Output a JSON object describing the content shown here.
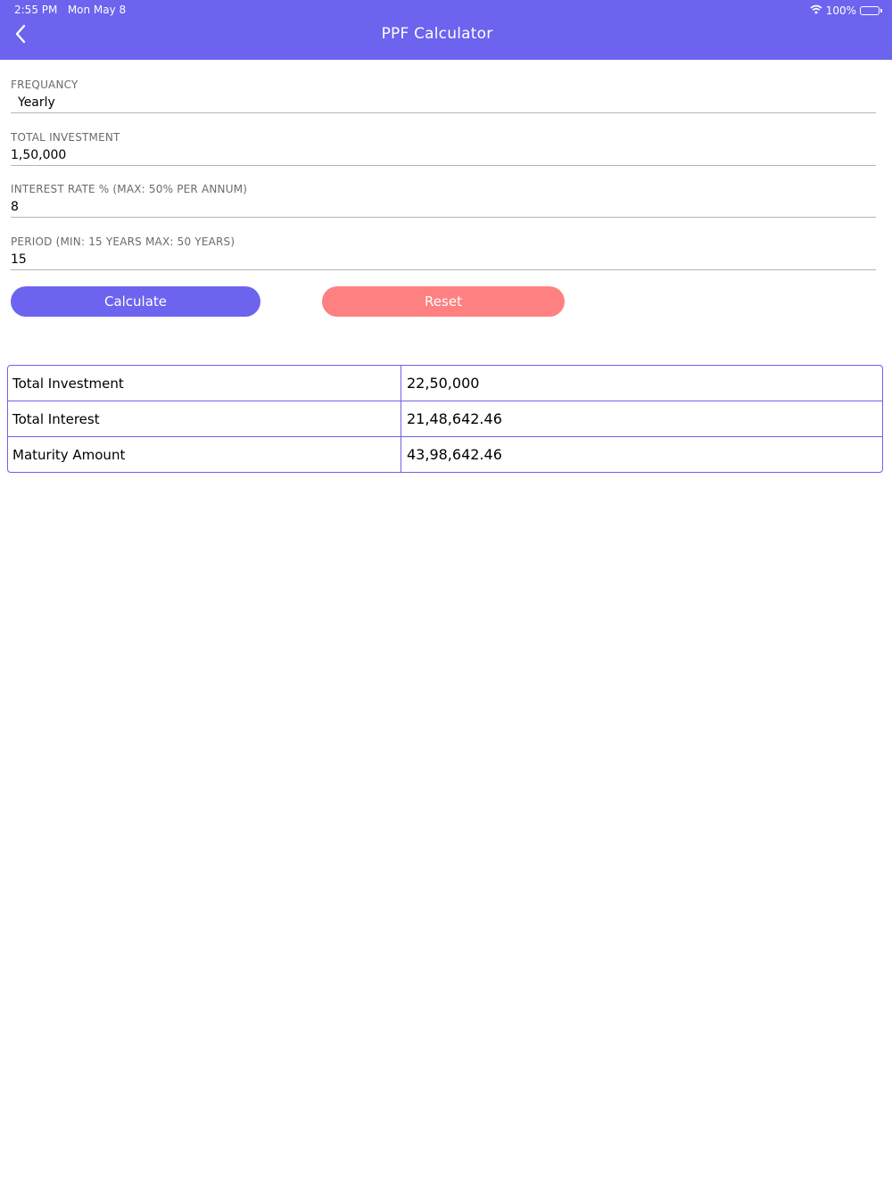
{
  "status_bar": {
    "time": "2:55 PM",
    "date": "Mon May 8",
    "battery": "100%",
    "wifi_icon": "wifi-icon",
    "battery_icon": "battery-icon"
  },
  "nav": {
    "title": "PPF Calculator",
    "back_icon": "chevron-left-icon"
  },
  "form": {
    "frequency": {
      "label": "FREQUANCY",
      "value": "Yearly"
    },
    "total_investment": {
      "label": "TOTAL INVESTMENT",
      "value": "1,50,000"
    },
    "interest_rate": {
      "label": "INTEREST RATE % (MAX: 50% PER ANNUM)",
      "value": "8"
    },
    "period": {
      "label": "PERIOD (MIN: 15 YEARS MAX: 50 YEARS)",
      "value": "15"
    }
  },
  "buttons": {
    "calculate": "Calculate",
    "reset": "Reset"
  },
  "results": [
    {
      "label": "Total Investment",
      "value": "22,50,000"
    },
    {
      "label": "Total Interest",
      "value": "21,48,642.46"
    },
    {
      "label": "Maturity Amount",
      "value": "43,98,642.46"
    }
  ],
  "colors": {
    "primary": "#6c63ef",
    "reset": "#fe8080"
  }
}
